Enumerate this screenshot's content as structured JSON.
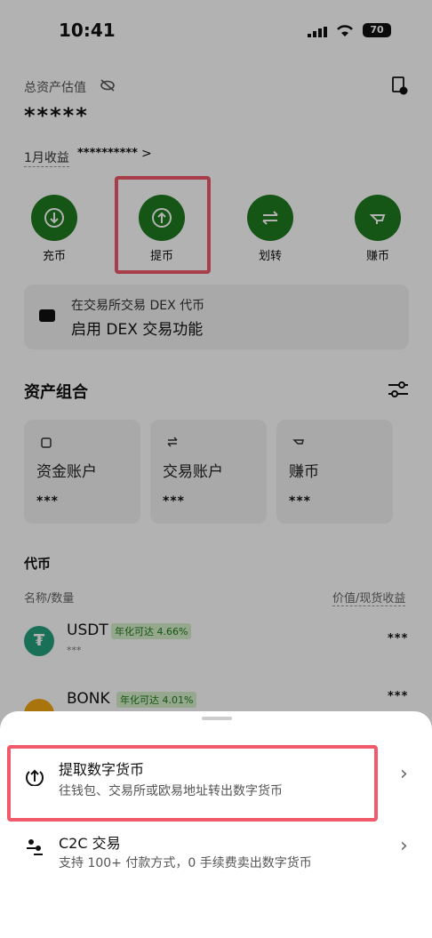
{
  "status_bar": {
    "time": "10:41",
    "battery": "70"
  },
  "header": {
    "total_label": "总资产估值",
    "total_value": "*****",
    "monthly_label": "1月收益",
    "monthly_value": "**********",
    "monthly_chevron": ">"
  },
  "actions": [
    {
      "label": "充币",
      "icon": "deposit-icon"
    },
    {
      "label": "提币",
      "icon": "withdraw-icon"
    },
    {
      "label": "划转",
      "icon": "transfer-icon"
    },
    {
      "label": "赚币",
      "icon": "earn-icon"
    }
  ],
  "dex_banner": {
    "line1": "在交易所交易 DEX 代币",
    "line2": "启用 DEX 交易功能"
  },
  "portfolio": {
    "title": "资产组合",
    "accounts": [
      {
        "name": "资金账户",
        "value": "***"
      },
      {
        "name": "交易账户",
        "value": "***"
      },
      {
        "name": "赚币",
        "value": "***"
      }
    ]
  },
  "tokens": {
    "title": "代币",
    "col_left": "名称/数量",
    "col_right": "价值/现货收益",
    "items": [
      {
        "symbol": "USDT",
        "apy": "年化可达 4.66%",
        "amount": "***",
        "value": "***"
      },
      {
        "symbol": "BONK",
        "apy": "年化可达 4.01%",
        "amount": "",
        "value": "***"
      }
    ]
  },
  "sheet": {
    "options": [
      {
        "title": "提取数字货币",
        "desc": "往钱包、交易所或欧易地址转出数字货币",
        "icon": "withdraw-icon"
      },
      {
        "title": "C2C 交易",
        "desc": "支持 100+ 付款方式，0 手续费卖出数字货币",
        "icon": "c2c-icon"
      }
    ],
    "chevron": "›"
  },
  "colors": {
    "accent_green": "#1f7a1f",
    "highlight": "#f15a6b"
  }
}
